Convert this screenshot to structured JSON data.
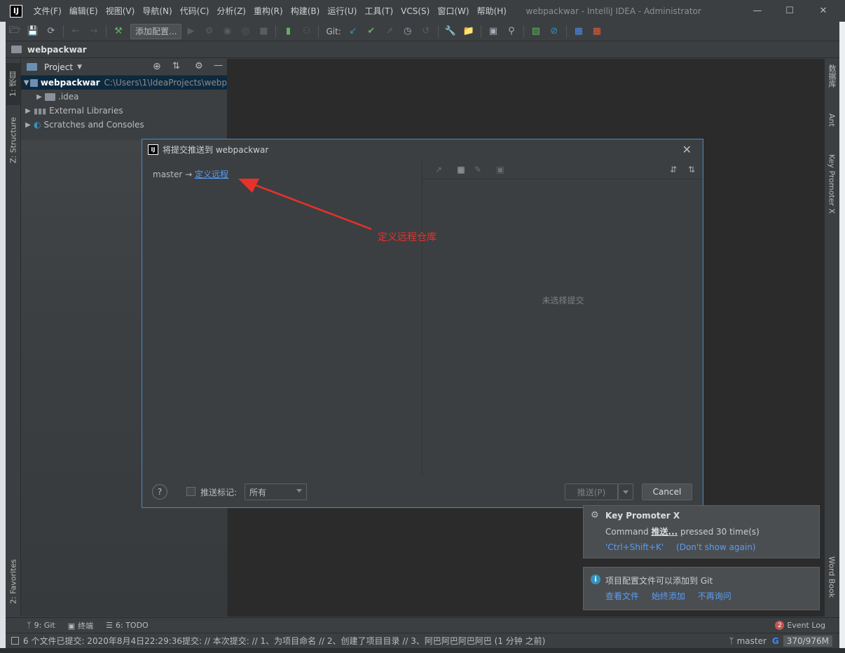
{
  "app": {
    "logo_text": "IJ",
    "window_title": "webpackwar - IntelliJ IDEA - Administrator",
    "menu": [
      "文件(F)",
      "编辑(E)",
      "视图(V)",
      "导航(N)",
      "代码(C)",
      "分析(Z)",
      "重构(R)",
      "构建(B)",
      "运行(U)",
      "工具(T)",
      "VCS(S)",
      "窗口(W)",
      "帮助(H)"
    ]
  },
  "toolbar": {
    "run_config_label": "添加配置...",
    "git_label": "Git:"
  },
  "navbar": {
    "project": "webpackwar"
  },
  "left_tabs": {
    "project": "1: 项目",
    "structure": "Z: Structure",
    "favorites": "2: Favorites"
  },
  "right_tabs": {
    "database": "数据库",
    "ant": "Ant",
    "key_promoter": "Key Promoter X",
    "word_book": "Word Book"
  },
  "project_panel": {
    "title": "Project",
    "tree": [
      {
        "name": "webpackwar",
        "path": "C:\\Users\\1\\IdeaProjects\\webp"
      },
      {
        "name": ".idea"
      },
      {
        "name": "External Libraries"
      },
      {
        "name": "Scratches and Consoles"
      }
    ]
  },
  "dialog": {
    "title": "将提交推送到 webpackwar",
    "branch": "master",
    "arrow": "→",
    "define_remote_link": "定义远程",
    "no_commit_selected": "未选择提交",
    "help_label": "?",
    "push_tags_label": "推送标记:",
    "push_tags_value": "所有",
    "push_button": "推送(P)",
    "cancel_button": "Cancel"
  },
  "annotation": {
    "text": "定义远程仓库",
    "color": "#e8312b"
  },
  "notifications": {
    "key_promoter": {
      "title": "Key Promoter X",
      "command_prefix": "Command",
      "command_name": "推送...",
      "command_suffix": "pressed 30 time(s)",
      "shortcut": "'Ctrl+Shift+K'",
      "dont_show": "(Don't show again)"
    },
    "git": {
      "text": "项目配置文件可以添加到 Git",
      "links": [
        "查看文件",
        "始终添加",
        "不再询问"
      ]
    }
  },
  "bottom_tabs": {
    "git": "9: Git",
    "terminal": "终端",
    "todo": "6: TODO",
    "event_log": "Event Log",
    "event_count": "2"
  },
  "status_bar": {
    "message": "6 个文件已提交: 2020年8月4日22:29:36提交:  // 本次提交:  // 1、为项目命名 // 2、创建了项目目录 // 3、阿巴阿巴阿巴阿巴 (1 分钟 之前)",
    "branch": "master",
    "memory": "370/976M"
  },
  "colors": {
    "accent": "#4a88c7",
    "link": "#589df6",
    "bg": "#3c3f41"
  }
}
